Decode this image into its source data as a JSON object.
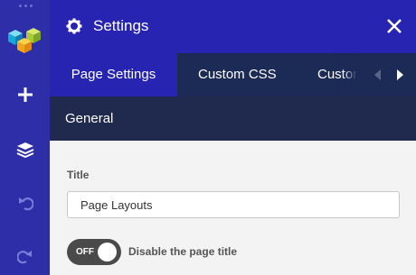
{
  "sidebar": {
    "items": [
      {
        "name": "add-icon"
      },
      {
        "name": "layers-icon"
      },
      {
        "name": "undo-icon"
      },
      {
        "name": "redo-icon"
      }
    ]
  },
  "header": {
    "title": "Settings",
    "icon": "gear-icon",
    "close_icon": "close-icon"
  },
  "tabs": [
    {
      "label": "Page Settings",
      "active": true
    },
    {
      "label": "Custom CSS",
      "active": false
    },
    {
      "label": "Custom",
      "active": false
    }
  ],
  "section": {
    "label": "General"
  },
  "form": {
    "title_label": "Title",
    "title_value": "Page Layouts",
    "toggle_state": "OFF",
    "toggle_label": "Disable the page title"
  },
  "colors": {
    "sidebar": "#2d2ea8",
    "header": "#2624b0",
    "tabs_bg": "#1c2b56",
    "section_bg": "#1f2a4e",
    "content_bg": "#f3f3f4",
    "toggle_off": "#4a4a4a"
  }
}
